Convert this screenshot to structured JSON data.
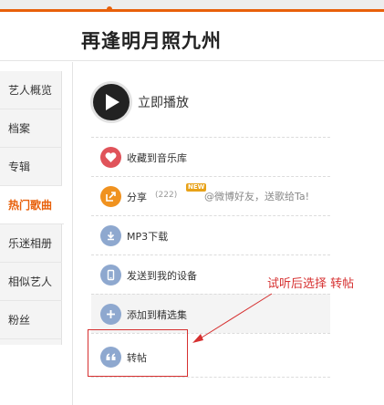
{
  "header": {
    "title": "再逢明月照九州"
  },
  "sidebar": {
    "items": [
      {
        "label": "艺人概览",
        "active": false
      },
      {
        "label": "档案",
        "active": false
      },
      {
        "label": "专辑",
        "active": false
      },
      {
        "label": "热门歌曲",
        "active": true
      },
      {
        "label": "乐迷相册",
        "active": false
      },
      {
        "label": "相似艺人",
        "active": false
      },
      {
        "label": "粉丝",
        "active": false
      }
    ]
  },
  "player": {
    "play_label": "立即播放",
    "icon": "play-icon"
  },
  "actions": [
    {
      "label": "收藏到音乐库",
      "icon": "heart-icon",
      "color": "#e0535a"
    },
    {
      "label": "分享",
      "count": "(222)",
      "badge": "NEW",
      "hint": "@微博好友，送歌给Ta!",
      "icon": "share-icon",
      "color": "#f0921f"
    },
    {
      "label": "MP3下载",
      "icon": "download-icon",
      "color": "#8ea8cf"
    },
    {
      "label": "发送到我的设备",
      "icon": "device-icon",
      "color": "#8ea8cf"
    },
    {
      "label": "添加到精选集",
      "icon": "plus-icon",
      "color": "#8ea8cf"
    },
    {
      "label": "转帖",
      "icon": "quote-icon",
      "color": "#8ea8cf"
    }
  ],
  "annotation": {
    "text": "试听后选择 转帖",
    "color": "#d63030"
  },
  "colors": {
    "accent": "#e8600a",
    "annotation": "#d63030",
    "icon_blue": "#8ea8cf"
  }
}
